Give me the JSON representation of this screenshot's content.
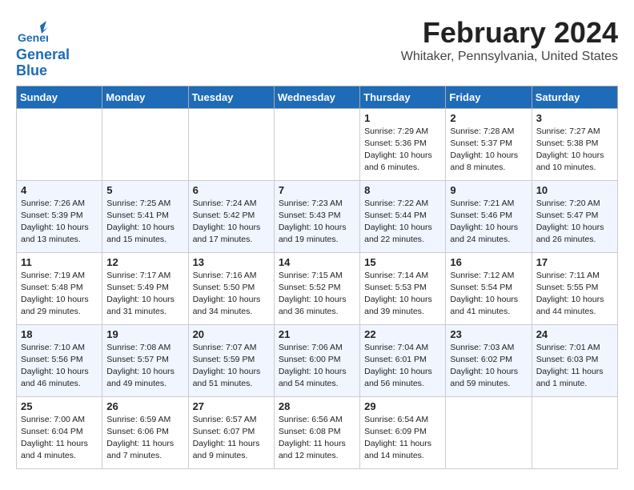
{
  "logo": {
    "general": "General",
    "blue": "Blue"
  },
  "header": {
    "title": "February 2024",
    "subtitle": "Whitaker, Pennsylvania, United States"
  },
  "weekdays": [
    "Sunday",
    "Monday",
    "Tuesday",
    "Wednesday",
    "Thursday",
    "Friday",
    "Saturday"
  ],
  "weeks": [
    [
      {
        "day": "",
        "info": ""
      },
      {
        "day": "",
        "info": ""
      },
      {
        "day": "",
        "info": ""
      },
      {
        "day": "",
        "info": ""
      },
      {
        "day": "1",
        "info": "Sunrise: 7:29 AM\nSunset: 5:36 PM\nDaylight: 10 hours\nand 6 minutes."
      },
      {
        "day": "2",
        "info": "Sunrise: 7:28 AM\nSunset: 5:37 PM\nDaylight: 10 hours\nand 8 minutes."
      },
      {
        "day": "3",
        "info": "Sunrise: 7:27 AM\nSunset: 5:38 PM\nDaylight: 10 hours\nand 10 minutes."
      }
    ],
    [
      {
        "day": "4",
        "info": "Sunrise: 7:26 AM\nSunset: 5:39 PM\nDaylight: 10 hours\nand 13 minutes."
      },
      {
        "day": "5",
        "info": "Sunrise: 7:25 AM\nSunset: 5:41 PM\nDaylight: 10 hours\nand 15 minutes."
      },
      {
        "day": "6",
        "info": "Sunrise: 7:24 AM\nSunset: 5:42 PM\nDaylight: 10 hours\nand 17 minutes."
      },
      {
        "day": "7",
        "info": "Sunrise: 7:23 AM\nSunset: 5:43 PM\nDaylight: 10 hours\nand 19 minutes."
      },
      {
        "day": "8",
        "info": "Sunrise: 7:22 AM\nSunset: 5:44 PM\nDaylight: 10 hours\nand 22 minutes."
      },
      {
        "day": "9",
        "info": "Sunrise: 7:21 AM\nSunset: 5:46 PM\nDaylight: 10 hours\nand 24 minutes."
      },
      {
        "day": "10",
        "info": "Sunrise: 7:20 AM\nSunset: 5:47 PM\nDaylight: 10 hours\nand 26 minutes."
      }
    ],
    [
      {
        "day": "11",
        "info": "Sunrise: 7:19 AM\nSunset: 5:48 PM\nDaylight: 10 hours\nand 29 minutes."
      },
      {
        "day": "12",
        "info": "Sunrise: 7:17 AM\nSunset: 5:49 PM\nDaylight: 10 hours\nand 31 minutes."
      },
      {
        "day": "13",
        "info": "Sunrise: 7:16 AM\nSunset: 5:50 PM\nDaylight: 10 hours\nand 34 minutes."
      },
      {
        "day": "14",
        "info": "Sunrise: 7:15 AM\nSunset: 5:52 PM\nDaylight: 10 hours\nand 36 minutes."
      },
      {
        "day": "15",
        "info": "Sunrise: 7:14 AM\nSunset: 5:53 PM\nDaylight: 10 hours\nand 39 minutes."
      },
      {
        "day": "16",
        "info": "Sunrise: 7:12 AM\nSunset: 5:54 PM\nDaylight: 10 hours\nand 41 minutes."
      },
      {
        "day": "17",
        "info": "Sunrise: 7:11 AM\nSunset: 5:55 PM\nDaylight: 10 hours\nand 44 minutes."
      }
    ],
    [
      {
        "day": "18",
        "info": "Sunrise: 7:10 AM\nSunset: 5:56 PM\nDaylight: 10 hours\nand 46 minutes."
      },
      {
        "day": "19",
        "info": "Sunrise: 7:08 AM\nSunset: 5:57 PM\nDaylight: 10 hours\nand 49 minutes."
      },
      {
        "day": "20",
        "info": "Sunrise: 7:07 AM\nSunset: 5:59 PM\nDaylight: 10 hours\nand 51 minutes."
      },
      {
        "day": "21",
        "info": "Sunrise: 7:06 AM\nSunset: 6:00 PM\nDaylight: 10 hours\nand 54 minutes."
      },
      {
        "day": "22",
        "info": "Sunrise: 7:04 AM\nSunset: 6:01 PM\nDaylight: 10 hours\nand 56 minutes."
      },
      {
        "day": "23",
        "info": "Sunrise: 7:03 AM\nSunset: 6:02 PM\nDaylight: 10 hours\nand 59 minutes."
      },
      {
        "day": "24",
        "info": "Sunrise: 7:01 AM\nSunset: 6:03 PM\nDaylight: 11 hours\nand 1 minute."
      }
    ],
    [
      {
        "day": "25",
        "info": "Sunrise: 7:00 AM\nSunset: 6:04 PM\nDaylight: 11 hours\nand 4 minutes."
      },
      {
        "day": "26",
        "info": "Sunrise: 6:59 AM\nSunset: 6:06 PM\nDaylight: 11 hours\nand 7 minutes."
      },
      {
        "day": "27",
        "info": "Sunrise: 6:57 AM\nSunset: 6:07 PM\nDaylight: 11 hours\nand 9 minutes."
      },
      {
        "day": "28",
        "info": "Sunrise: 6:56 AM\nSunset: 6:08 PM\nDaylight: 11 hours\nand 12 minutes."
      },
      {
        "day": "29",
        "info": "Sunrise: 6:54 AM\nSunset: 6:09 PM\nDaylight: 11 hours\nand 14 minutes."
      },
      {
        "day": "",
        "info": ""
      },
      {
        "day": "",
        "info": ""
      }
    ]
  ]
}
